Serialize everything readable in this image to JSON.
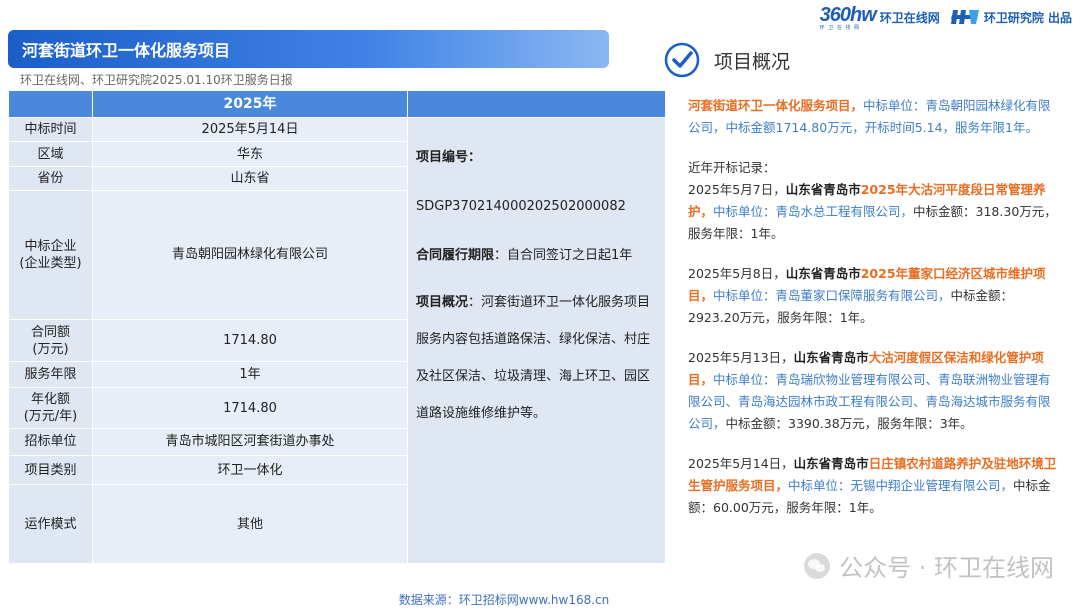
{
  "header": {
    "site_logo_text": "360hw",
    "site_logo_sub": "环 卫 在 线 网",
    "site_name": "环卫在线网",
    "publisher": "环卫研究院 出品"
  },
  "title": "河套街道环卫一体化服务项目",
  "source_line": "环卫在线网、环卫研究院2025.01.10环卫服务日报",
  "table": {
    "year_header": "2025年",
    "rows": [
      {
        "label": "中标时间",
        "value": "2025年5月14日"
      },
      {
        "label": "区域",
        "value": "华东"
      },
      {
        "label": "省份",
        "value": "山东省"
      },
      {
        "label": "中标企业\n(企业类型)",
        "value": "青岛朝阳园林绿化有限公司"
      },
      {
        "label": "合同额\n(万元)",
        "value": "1714.80"
      },
      {
        "label": "服务年限",
        "value": "1年"
      },
      {
        "label": "年化额\n(万元/年)",
        "value": "1714.80"
      },
      {
        "label": "招标单位",
        "value": "青岛市城阳区河套街道办事处"
      },
      {
        "label": "项目类别",
        "value": "环卫一体化"
      },
      {
        "label": "运作模式",
        "value": "其他"
      }
    ],
    "project_no_label": "项目编号：",
    "project_no": "SDGP370214000202502000082",
    "contract_label": "合同履行期限",
    "contract_value": "：自合同签订之日起1年",
    "overview_label": "项目概况",
    "overview_value": "：河套街道环卫一体化服务项目服务内容包括道路保洁、绿化保洁、村庄及社区保洁、垃圾清理、海上环卫、园区道路设施维修维护等。"
  },
  "overview": {
    "heading": "项目概况",
    "intro_project": "河套街道环卫一体化服务项目，",
    "intro_rest": "中标单位：青岛朝阳园林绿化有限公司，中标金额1714.80万元，开标时间5.14，服务年限1年。",
    "records_title": "近年开标记录：",
    "records": [
      {
        "date": "2025年5月7日，",
        "place": "山东省青岛市",
        "project": "2025年大沽河平度段日常管理养护，",
        "winner": "中标单位：青岛水总工程有限公司，",
        "rest": "中标金额：318.30万元，服务年限：1年。"
      },
      {
        "date": "2025年5月8日，",
        "place": "山东省青岛市",
        "project": "2025年董家口经济区城市维护项目，",
        "winner": "中标单位：青岛董家口保障服务有限公司，",
        "rest": "中标金额：2923.20万元，服务年限：1年。"
      },
      {
        "date": "2025年5月13日，",
        "place": "山东省青岛市",
        "project": "大沽河度假区保洁和绿化管护项目，",
        "winner": "中标单位：青岛瑞欣物业管理有限公司、青岛联洲物业管理有限公司、青岛海达园林市政工程有限公司、青岛海达城市服务有限公司，",
        "rest": "中标金额：3390.38万元，服务年限：3年。"
      },
      {
        "date": "2025年5月14日，",
        "place": "山东省青岛市",
        "project": "日庄镇农村道路养护及驻地环境卫生管护服务项目，",
        "winner": "中标单位：无锡中翔企业管理有限公司，",
        "rest": "中标金额：60.00万元，服务年限：1年。"
      }
    ]
  },
  "footer_source": "数据来源：环卫招标网www.hw168.cn",
  "watermark": "公众号 · 环卫在线网",
  "colors": {
    "title_bar": "#1a5ec8",
    "table_header": "#4a88dc",
    "accent_orange": "#e96d22",
    "accent_blue": "#3d7ec8"
  }
}
